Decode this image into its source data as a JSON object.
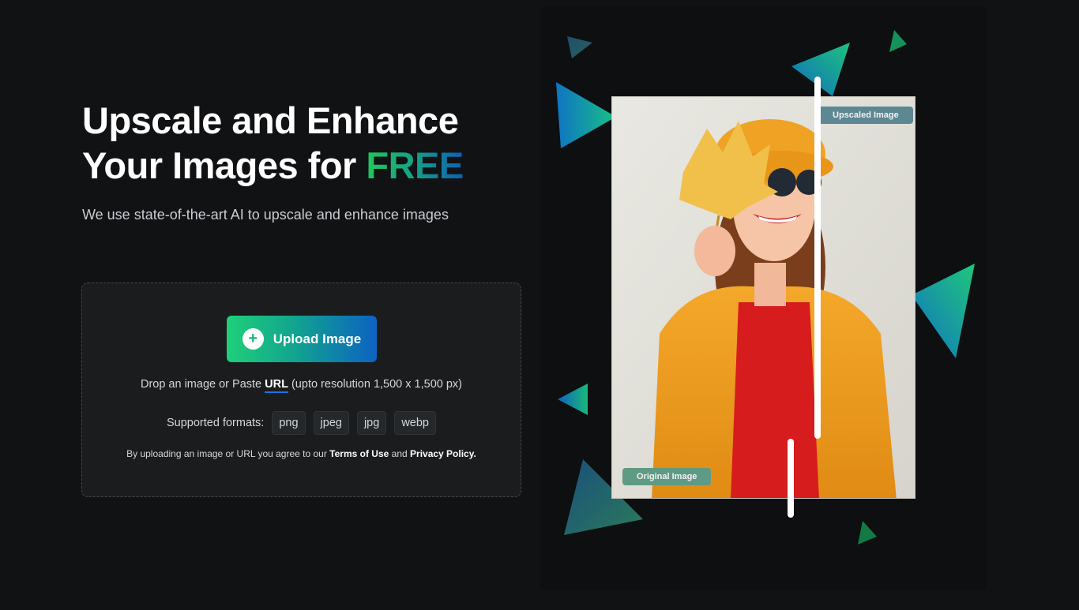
{
  "hero": {
    "title_line1": "Upscale and Enhance",
    "title_line2_prefix": "Your Images for ",
    "title_highlight": "FREE",
    "subtitle": "We use state-of-the-art AI to upscale and enhance images"
  },
  "upload": {
    "button_label": "Upload Image",
    "plus_glyph": "+",
    "drop_prefix": "Drop an image or Paste ",
    "url_link": "URL",
    "drop_suffix": " (upto resolution 1,500 x 1,500 px)",
    "formats_label": "Supported formats:",
    "formats": [
      "png",
      "jpeg",
      "jpg",
      "webp"
    ],
    "terms_prefix": "By uploading an image or URL you agree to our ",
    "terms_link": "Terms of Use",
    "terms_and": " and ",
    "privacy_link": "Privacy Policy."
  },
  "showcase": {
    "upscaled_label": "Upscaled Image",
    "original_label": "Original Image"
  },
  "colors": {
    "background": "#111214",
    "accent_green": "#22c55e",
    "accent_blue": "#0b5fb8",
    "link_underline": "#1a73e8"
  }
}
